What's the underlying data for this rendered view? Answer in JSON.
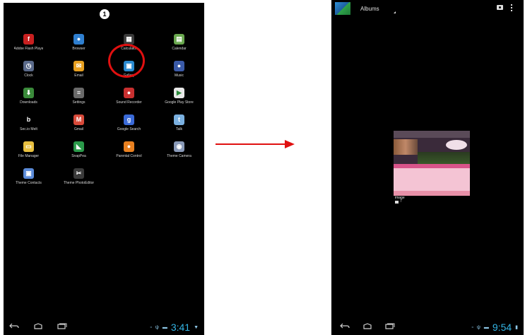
{
  "left_phone": {
    "step_number": "1",
    "apps": [
      {
        "label": "Adobe Flash Playe",
        "icon": "flash-icon",
        "color": "#c82020",
        "glyph": "f"
      },
      {
        "label": "Browser",
        "icon": "globe-icon",
        "color": "#2f7fd0",
        "glyph": "●"
      },
      {
        "label": "Calculator",
        "icon": "calculator-icon",
        "color": "#3a3a3a",
        "glyph": "▦"
      },
      {
        "label": "Calendar",
        "icon": "calendar-icon",
        "color": "#6aa84f",
        "glyph": "▤"
      },
      {
        "label": "Clock",
        "icon": "clock-icon",
        "color": "#5a6a8a",
        "glyph": "◷"
      },
      {
        "label": "Email",
        "icon": "email-icon",
        "color": "#e8a020",
        "glyph": "✉"
      },
      {
        "label": "Gallery",
        "icon": "gallery-icon",
        "color": "#2a8ad0",
        "glyph": "▣"
      },
      {
        "label": "Music",
        "icon": "music-icon",
        "color": "#3a5aa8",
        "glyph": "●"
      },
      {
        "label": "Downloads",
        "icon": "download-icon",
        "color": "#3a8a3a",
        "glyph": "⬇"
      },
      {
        "label": "Settings",
        "icon": "settings-icon",
        "color": "#6a6a6a",
        "glyph": "≡"
      },
      {
        "label": "Sound Recorder",
        "icon": "microphone-icon",
        "color": "#c83030",
        "glyph": "●"
      },
      {
        "label": "Google Play Store",
        "icon": "play-store-icon",
        "color": "#e8e8e8",
        "glyph": "▶"
      },
      {
        "label": "Sec.io Melt",
        "icon": "melt-icon",
        "color": "#000000",
        "glyph": "b"
      },
      {
        "label": "Gmail",
        "icon": "gmail-icon",
        "color": "#d84a3a",
        "glyph": "M"
      },
      {
        "label": "Google Search",
        "icon": "google-search-icon",
        "color": "#3a6ad8",
        "glyph": "g"
      },
      {
        "label": "Talk",
        "icon": "talk-icon",
        "color": "#7ab0e0",
        "glyph": "t"
      },
      {
        "label": "File Manager",
        "icon": "folder-icon",
        "color": "#e8c040",
        "glyph": "▭"
      },
      {
        "label": "SnapPea",
        "icon": "snappea-icon",
        "color": "#2a9a4a",
        "glyph": "◣"
      },
      {
        "label": "Parental Control",
        "icon": "parental-control-icon",
        "color": "#e88020",
        "glyph": "●"
      },
      {
        "label": "Theme Camera",
        "icon": "camera-icon",
        "color": "#8a9ab8",
        "glyph": "◉"
      },
      {
        "label": "Theme Contacts",
        "icon": "contacts-icon",
        "color": "#5a8ad8",
        "glyph": "▣"
      },
      {
        "label": "Theme PhotoEditor",
        "icon": "photo-editor-icon",
        "color": "#3a3a3a",
        "glyph": "✂"
      }
    ],
    "status": {
      "clock": "3:41"
    }
  },
  "right_phone": {
    "header": {
      "title": "Albums"
    },
    "album": {
      "label": "image",
      "count": "7"
    },
    "status": {
      "clock": "9:54"
    }
  },
  "colors": {
    "highlight": "#e01010",
    "arrow": "#e01010",
    "clock": "#33b5e5"
  }
}
